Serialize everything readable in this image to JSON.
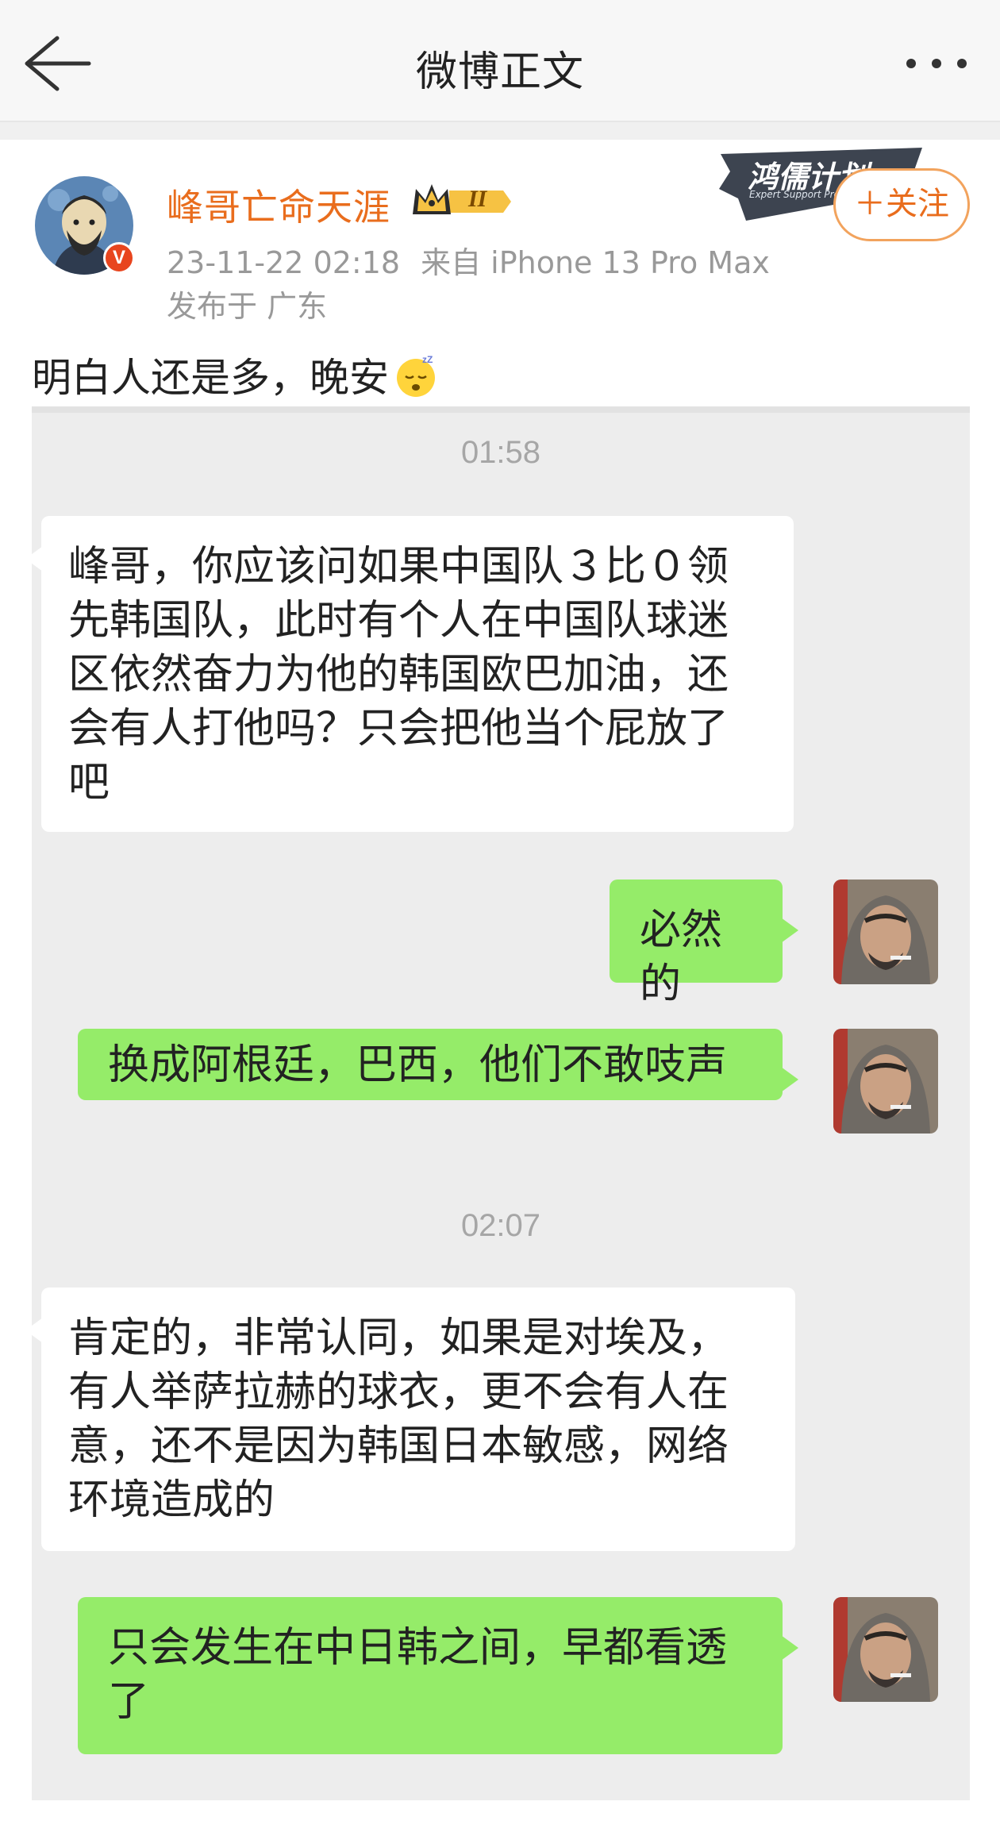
{
  "nav": {
    "title": "微博正文",
    "back_icon": "arrow-left-icon",
    "more_icon": "more-dots-icon"
  },
  "post": {
    "username": "峰哥亡命天涯",
    "level": "II",
    "datetime": "23-11-22 02:18",
    "source": "来自 iPhone 13 Pro Max",
    "location": "发布于 广东",
    "verified_mark": "V",
    "banner_title": "鸿儒计划",
    "banner_subtitle": "Expert Support Pro",
    "follow_label": "＋关注",
    "text": "明白人还是多，晚安",
    "emoji": "sleeping-face-icon"
  },
  "chat": {
    "time_1": "01:58",
    "msg_1": "峰哥，你应该问如果中国队３比０领先韩国队，此时有个人在中国队球迷区依然奋力为他的韩国欧巴加油，还会有人打他吗？只会把他当个屁放了吧",
    "msg_2": "必然的",
    "msg_3": "换成阿根廷，巴西，他们不敢吱声",
    "time_2": "02:07",
    "msg_4": "肯定的，非常认同，如果是对埃及，有人举萨拉赫的球衣，更不会有人在意，还不是因为韩国日本敏感，网络环境造成的",
    "msg_5": "只会发生在中日韩之间，早都看透了"
  },
  "colors": {
    "accent": "#e96d1d",
    "chat_bg": "#ededed",
    "bubble_out": "#95ec69",
    "bubble_in": "#ffffff"
  }
}
